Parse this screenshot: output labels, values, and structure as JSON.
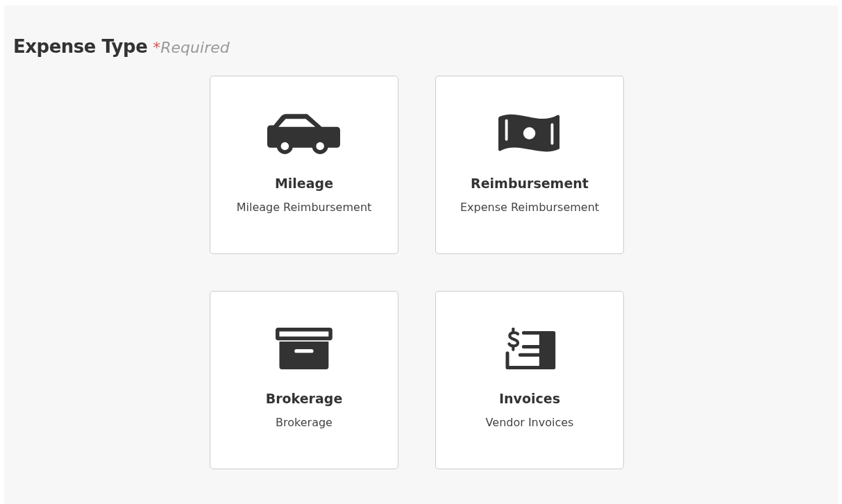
{
  "heading": {
    "title": "Expense Type",
    "required_mark": "*",
    "required_label": "Required"
  },
  "options": [
    {
      "kind": "car",
      "title": "Mileage",
      "subtitle": "Mileage Reimbursement"
    },
    {
      "kind": "money",
      "title": "Reimbursement",
      "subtitle": "Expense Reimbursement"
    },
    {
      "kind": "box",
      "title": "Brokerage",
      "subtitle": "Brokerage"
    },
    {
      "kind": "invoice",
      "title": "Invoices",
      "subtitle": "Vendor Invoices"
    }
  ]
}
